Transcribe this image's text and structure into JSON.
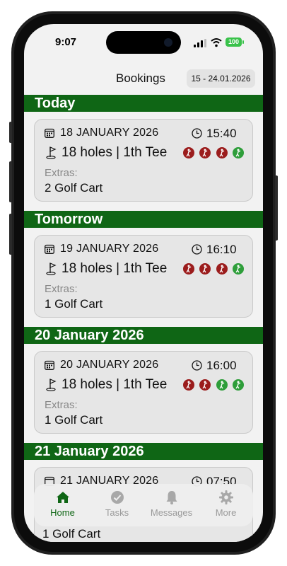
{
  "status": {
    "time": "9:07",
    "battery": "100"
  },
  "header": {
    "title": "Bookings",
    "date_range": "15 - 24.01.2026"
  },
  "colors": {
    "brand_green": "#0f6615",
    "player_red": "#9b1c1c",
    "player_green": "#2e9e3a"
  },
  "sections": [
    {
      "title": "Today",
      "booking": {
        "date": "18 JANUARY 2026",
        "time": "15:40",
        "holes": "18 holes | 1th Tee",
        "players": [
          "red",
          "red",
          "red",
          "green"
        ],
        "extras_label": "Extras:",
        "extras": "2 Golf Cart"
      }
    },
    {
      "title": "Tomorrow",
      "booking": {
        "date": "19 JANUARY 2026",
        "time": "16:10",
        "holes": "18 holes | 1th Tee",
        "players": [
          "red",
          "red",
          "red",
          "green"
        ],
        "extras_label": "Extras:",
        "extras": "1 Golf Cart"
      }
    },
    {
      "title": "20 January 2026",
      "booking": {
        "date": "20 JANUARY 2026",
        "time": "16:00",
        "holes": "18 holes | 1th Tee",
        "players": [
          "red",
          "red",
          "green",
          "green"
        ],
        "extras_label": "Extras:",
        "extras": "1 Golf Cart"
      }
    },
    {
      "title": "21 January 2026",
      "booking": {
        "date": "21 JANUARY 2026",
        "time": "07:50",
        "extras": "1 Golf Cart"
      }
    }
  ],
  "tabs": [
    {
      "label": "Home",
      "icon": "home-icon",
      "active": true
    },
    {
      "label": "Tasks",
      "icon": "check-circle-icon",
      "active": false
    },
    {
      "label": "Messages",
      "icon": "bell-icon",
      "active": false
    },
    {
      "label": "More",
      "icon": "gear-icon",
      "active": false
    }
  ]
}
